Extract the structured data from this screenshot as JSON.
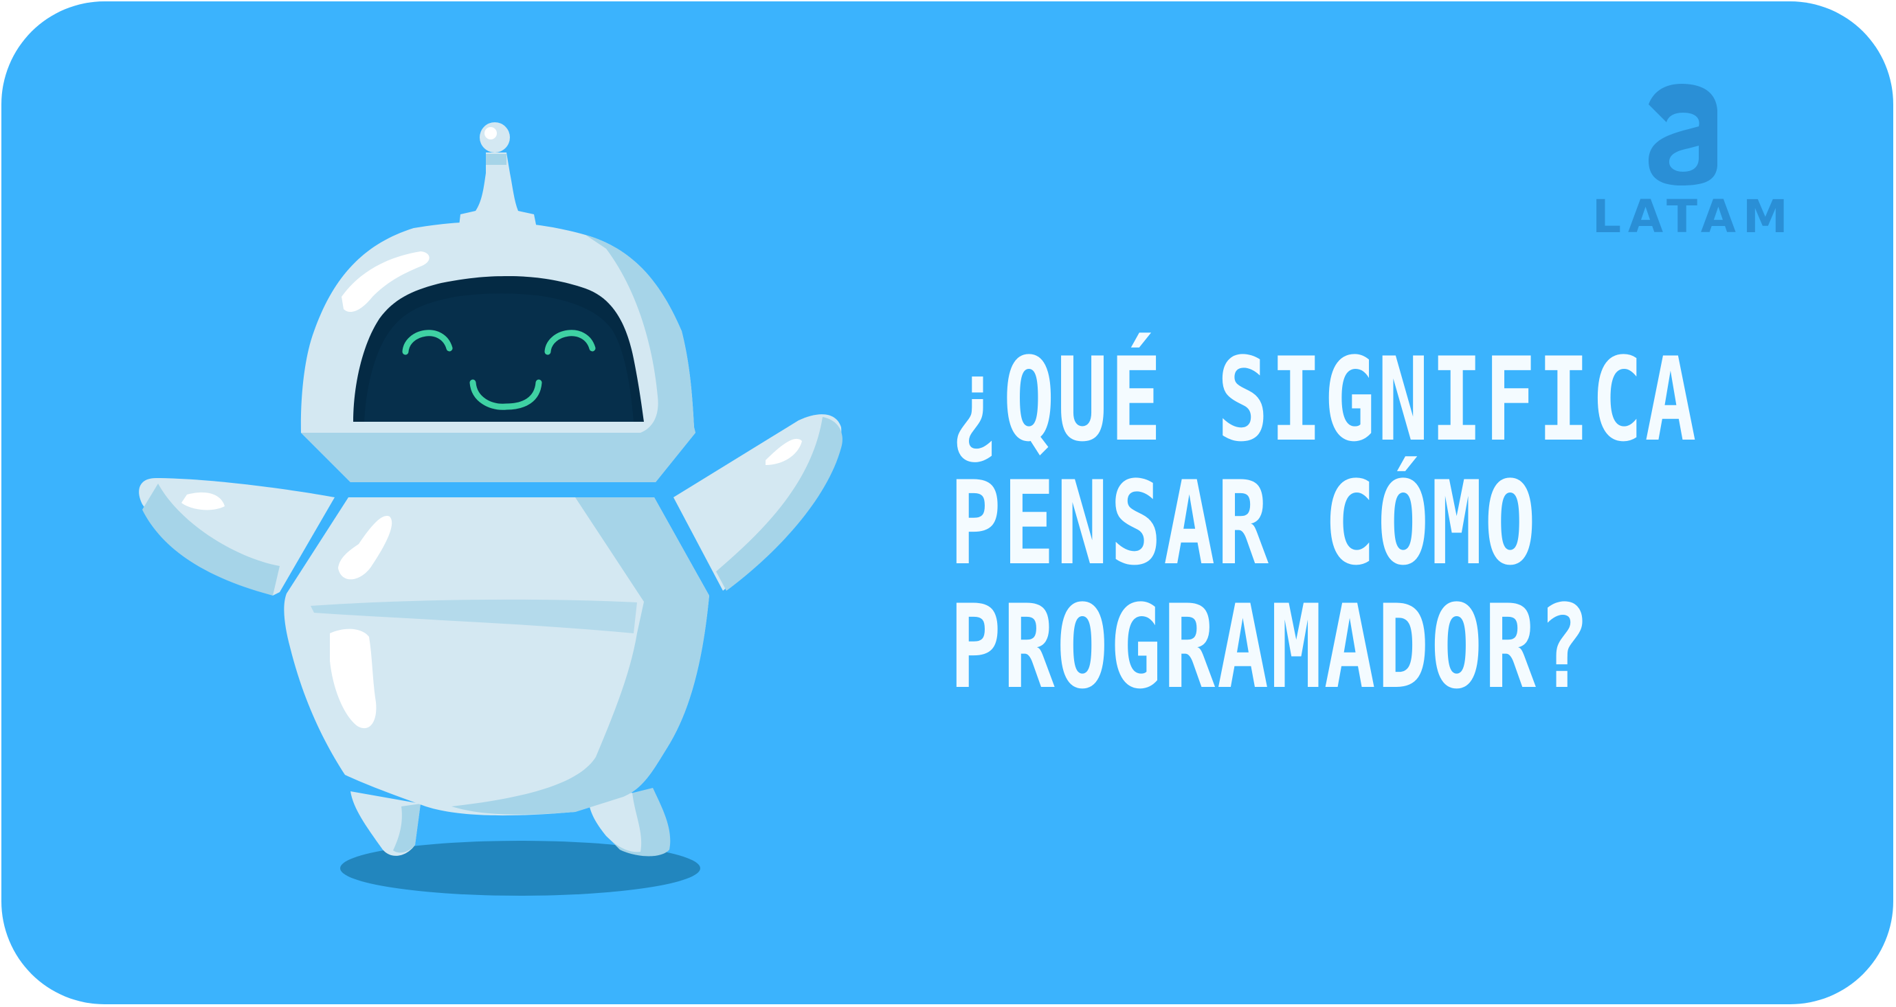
{
  "brand": {
    "logo_letter": "a",
    "logo_text": "LATAM"
  },
  "headline": {
    "lines": [
      "¿QUÉ SIGNIFICA",
      "PENSAR CÓMO",
      "PROGRAMADOR?"
    ]
  },
  "colors": {
    "background": "#3bb3fd",
    "robot_body": "#d4e8f2",
    "robot_shade": "#a6d4e8",
    "robot_face": "#042a44",
    "robot_eyes": "#3fd1a3",
    "logo": "#2a8fd6",
    "text": "#f4fbff"
  },
  "illustration": {
    "subject": "robot-mascot"
  }
}
